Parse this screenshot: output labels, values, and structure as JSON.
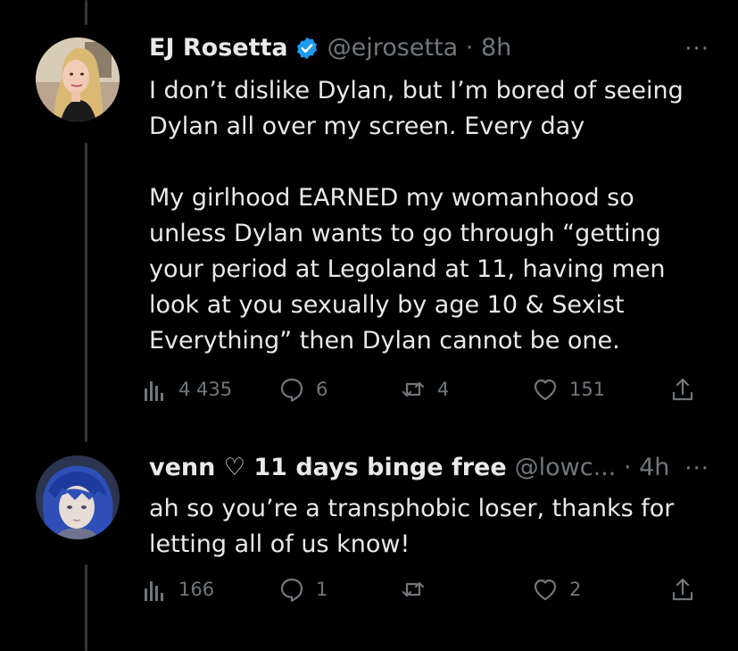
{
  "tweets": [
    {
      "name": "EJ Rosetta",
      "handle_time": "@ejrosetta · 8h",
      "more": "···",
      "text": "I don’t dislike Dylan, but I’m bored of seeing Dylan all over my screen. Every day\n\nMy girlhood EARNED my womanhood so unless Dylan wants to go through “getting your period at Legoland at 11, having men look at you sexually by age 10 & Sexist Everything” then Dylan cannot be one.",
      "views": "4 435",
      "replies": "6",
      "retweets": "4",
      "likes": "151",
      "verified": true
    },
    {
      "name": "venn ♡ 11 days binge free",
      "handle_time": "@lowc... · 4h",
      "more": "···",
      "text": "ah so you’re a transphobic loser, thanks for letting all of us know!",
      "views": "166",
      "replies": "1",
      "retweets": "",
      "likes": "2",
      "verified": false
    }
  ],
  "icons": {
    "verified": "verified-badge-icon",
    "views": "bar-chart-icon",
    "reply": "speech-bubble-icon",
    "retweet": "retweet-arrows-icon",
    "like": "heart-icon",
    "share": "share-upload-icon",
    "more": "ellipsis-icon"
  },
  "colors": {
    "background": "#000000",
    "text": "#e7e9ea",
    "secondary": "#71767b",
    "verified_blue": "#1d9bf0",
    "thread_line": "#333639"
  }
}
